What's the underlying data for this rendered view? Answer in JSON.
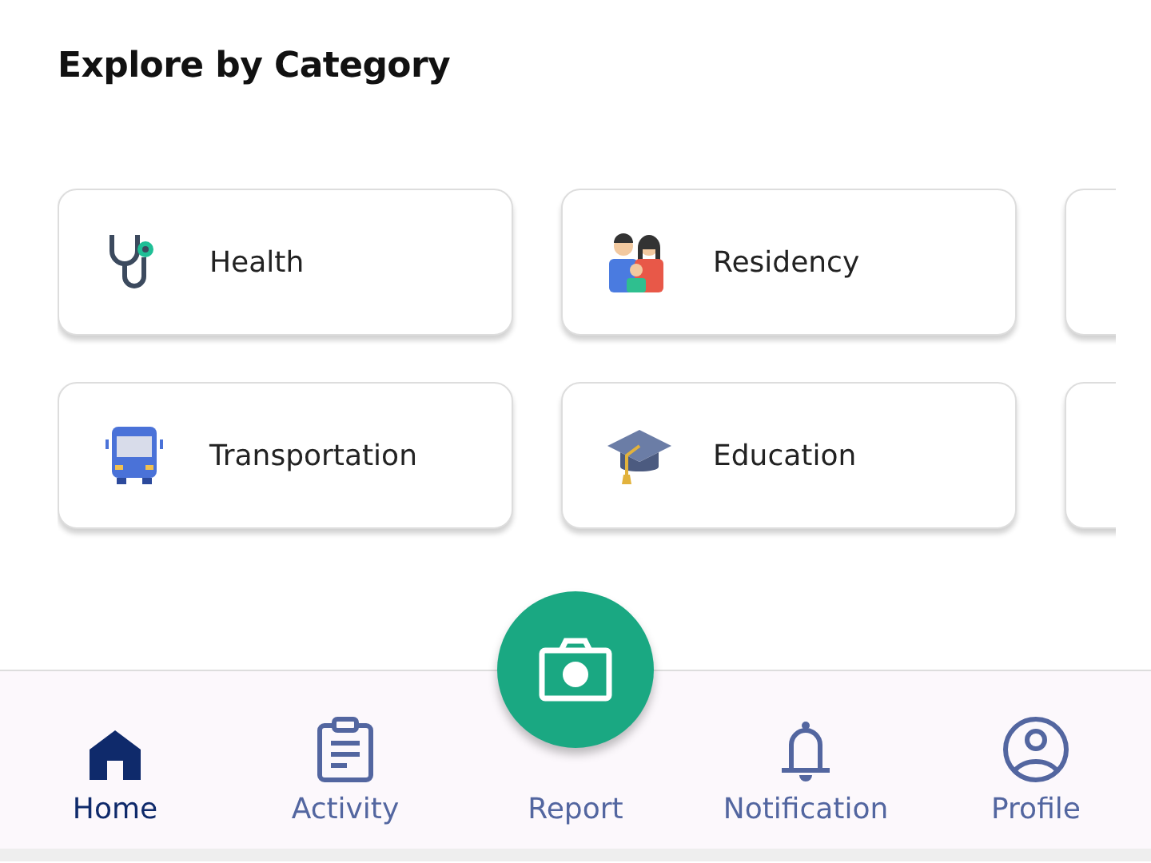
{
  "title": "Explore by Category",
  "categories": [
    {
      "kind": "health",
      "label": "Health"
    },
    {
      "kind": "residency",
      "label": "Residency"
    },
    {
      "kind": "cut"
    },
    {
      "kind": "transport",
      "label": "Transportation"
    },
    {
      "kind": "education",
      "label": "Education"
    },
    {
      "kind": "cut"
    }
  ],
  "nav": [
    {
      "kind": "home",
      "label": "Home",
      "selected": true
    },
    {
      "kind": "activity",
      "label": "Activity",
      "selected": false
    },
    {
      "kind": "report",
      "label": "Report",
      "selected": false
    },
    {
      "kind": "notification",
      "label": "Notification",
      "selected": false
    },
    {
      "kind": "profile",
      "label": "Profile",
      "selected": false
    }
  ]
}
